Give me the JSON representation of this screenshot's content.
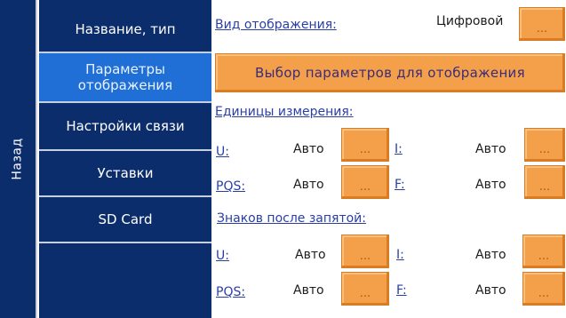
{
  "back": {
    "label": "Назад"
  },
  "menu": {
    "items": [
      {
        "label": "Название, тип"
      },
      {
        "label": "Параметры отображения"
      },
      {
        "label": "Настройки связи"
      },
      {
        "label": "Уставки"
      },
      {
        "label": "SD Card"
      }
    ]
  },
  "display": {
    "mode_label": "Вид отображения:",
    "mode_value": "Цифровой",
    "select_params_button": "Выбор параметров для отображения"
  },
  "units": {
    "heading": "Единицы измерения:",
    "u_label": "U:",
    "u_value": "Авто",
    "i_label": "I:",
    "i_value": "Авто",
    "pqs_label": "PQS:",
    "pqs_value": "Авто",
    "f_label": "F:",
    "f_value": "Авто"
  },
  "decimals": {
    "heading": "Знаков после запятой:",
    "u_label": "U:",
    "u_value": "Авто",
    "i_label": "I:",
    "i_value": "Авто",
    "pqs_label": "PQS:",
    "pqs_value": "Авто",
    "f_label": "F:",
    "f_value": "Авто"
  },
  "button_ellipsis": "..."
}
